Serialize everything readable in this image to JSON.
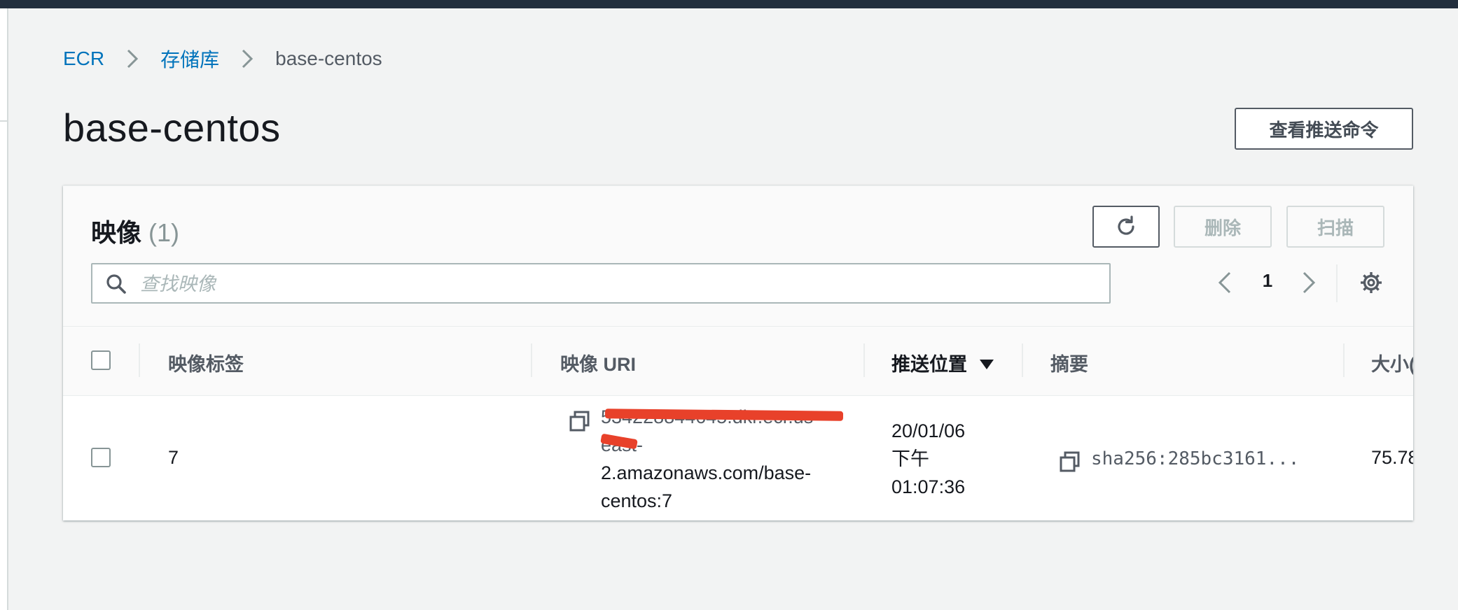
{
  "breadcrumb": {
    "items": [
      "ECR",
      "存储库"
    ],
    "current": "base-centos"
  },
  "page": {
    "title": "base-centos",
    "push_commands_label": "查看推送命令"
  },
  "images_panel": {
    "title": "映像",
    "count": "(1)",
    "refresh_label": "refresh",
    "delete_label": "删除",
    "scan_label": "扫描",
    "search_placeholder": "查找映像",
    "page_number": "1"
  },
  "table": {
    "columns": [
      "映像标签",
      "映像 URI",
      "推送位置",
      "摘要",
      "大小("
    ],
    "sorted_column_index": 2,
    "rows": [
      {
        "tag": "7",
        "uri": "534228844645.dkr.ecr.us-east-2.amazonaws.com/base-centos:7",
        "uri_lines": [
          "534228844645.dkr.ecr.us",
          "east-",
          "2.amazonaws.com/base-",
          "centos:7"
        ],
        "pushed_at_lines": [
          "20/01/06",
          "下午",
          "01:07:36"
        ],
        "digest": "sha256:285bc3161...",
        "size": "75.78"
      }
    ]
  },
  "colors": {
    "link": "#0073bb",
    "topbar": "#232f3e",
    "redaction": "#e8412a"
  },
  "icons": {
    "breadcrumb_separator": "chevron-right-icon",
    "refresh": "refresh-icon",
    "search": "search-icon",
    "prev": "chevron-left-icon",
    "next": "chevron-right-icon",
    "settings": "gear-icon",
    "sort": "caret-down-icon",
    "copy": "copy-icon"
  }
}
